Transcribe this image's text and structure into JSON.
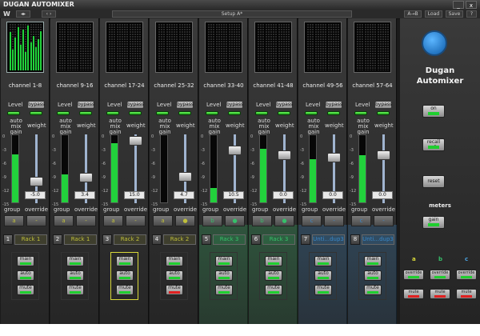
{
  "window": {
    "title": "DUGAN AUTOMIXER",
    "minimize_label": "_",
    "close_label": "x"
  },
  "toolbar": {
    "logo": "W",
    "left_btn_1": "◂▸",
    "left_btn_2": "‹ ›",
    "setup_label": "Setup A*",
    "ab_label": "A→B",
    "load_label": "Load",
    "save_label": "Save",
    "help_label": "?"
  },
  "labels": {
    "level": "Level",
    "bypass": "bypass",
    "auto_mix_gain": "auto\nmix gain",
    "weight": "weight",
    "group": "group",
    "override": "override",
    "main": "main",
    "auto": "auto",
    "mute": "mute"
  },
  "scale": [
    "0",
    "-3",
    "-6",
    "-9",
    "-12",
    "-15"
  ],
  "channels": [
    {
      "name": "channel 1-8",
      "number": "1",
      "rack": "Rack 1",
      "group": "a",
      "group_color": "#bfbf3a",
      "override_label": "-",
      "weight": "-5.0",
      "gain_level": 0.72,
      "weight_level": 0.32,
      "meter_active": true,
      "mute_on": false,
      "highlighted": false
    },
    {
      "name": "channel 9-16",
      "number": "2",
      "rack": "Rack 1",
      "group": "a",
      "group_color": "#bfbf3a",
      "override_label": "-",
      "weight": "3.4",
      "gain_level": 0.42,
      "weight_level": 0.38,
      "meter_active": false,
      "mute_on": false,
      "highlighted": false
    },
    {
      "name": "channel 17-24",
      "number": "3",
      "rack": "Rack 2",
      "group": "a",
      "group_color": "#bfbf3a",
      "override_label": "-",
      "weight": "15.0",
      "gain_level": 0.88,
      "weight_level": 0.98,
      "meter_active": false,
      "mute_on": false,
      "highlighted": true
    },
    {
      "name": "channel 25-32",
      "number": "4",
      "rack": "Rack 2",
      "group": "a",
      "group_color": "#bfbf3a",
      "override_label": "●",
      "weight": "4.7",
      "gain_level": 0.0,
      "weight_level": 0.4,
      "meter_active": false,
      "mute_on": true,
      "highlighted": false
    },
    {
      "name": "channel 33-40",
      "number": "5",
      "rack": "Rack 3",
      "group": "b",
      "group_color": "#36c06a",
      "override_label": "●",
      "weight": "10.5",
      "gain_level": 0.22,
      "weight_level": 0.82,
      "meter_active": false,
      "mute_on": false,
      "highlighted": false
    },
    {
      "name": "channel 41-48",
      "number": "6",
      "rack": "Rack 3",
      "group": "b",
      "group_color": "#36c06a",
      "override_label": "●",
      "weight": "0.0",
      "gain_level": 0.8,
      "weight_level": 0.74,
      "meter_active": false,
      "mute_on": false,
      "highlighted": false
    },
    {
      "name": "channel 49-56",
      "number": "7",
      "rack": "Unti...dup3",
      "group": "c",
      "group_color": "#3a88c8",
      "override_label": "-",
      "weight": "0.0",
      "gain_level": 0.64,
      "weight_level": 0.7,
      "meter_active": false,
      "mute_on": false,
      "highlighted": false
    },
    {
      "name": "channel 57-64",
      "number": "8",
      "rack": "Unti...dup3",
      "group": "c",
      "group_color": "#3a88c8",
      "override_label": "-",
      "weight": "0.0",
      "gain_level": 0.7,
      "weight_level": 0.74,
      "meter_active": false,
      "mute_on": false,
      "highlighted": false
    }
  ],
  "master": {
    "logo_text_1": "Dugan",
    "logo_text_2": "Automixer",
    "on_label": "on",
    "recall_label": "recall safe",
    "reset_label": "reset",
    "meters_label": "meters",
    "gain_label": "gain",
    "groups": [
      {
        "letter": "a",
        "color": "#d8d83a"
      },
      {
        "letter": "b",
        "color": "#36c06a"
      },
      {
        "letter": "c",
        "color": "#4aa2e0"
      }
    ],
    "override_label": "override",
    "mute_label": "mute"
  },
  "colors": {
    "meter_green": "#21d33b",
    "mute_red": "#e02020",
    "group_a": "#bfbf3a",
    "group_b": "#36c06a",
    "group_c": "#3a88c8"
  }
}
